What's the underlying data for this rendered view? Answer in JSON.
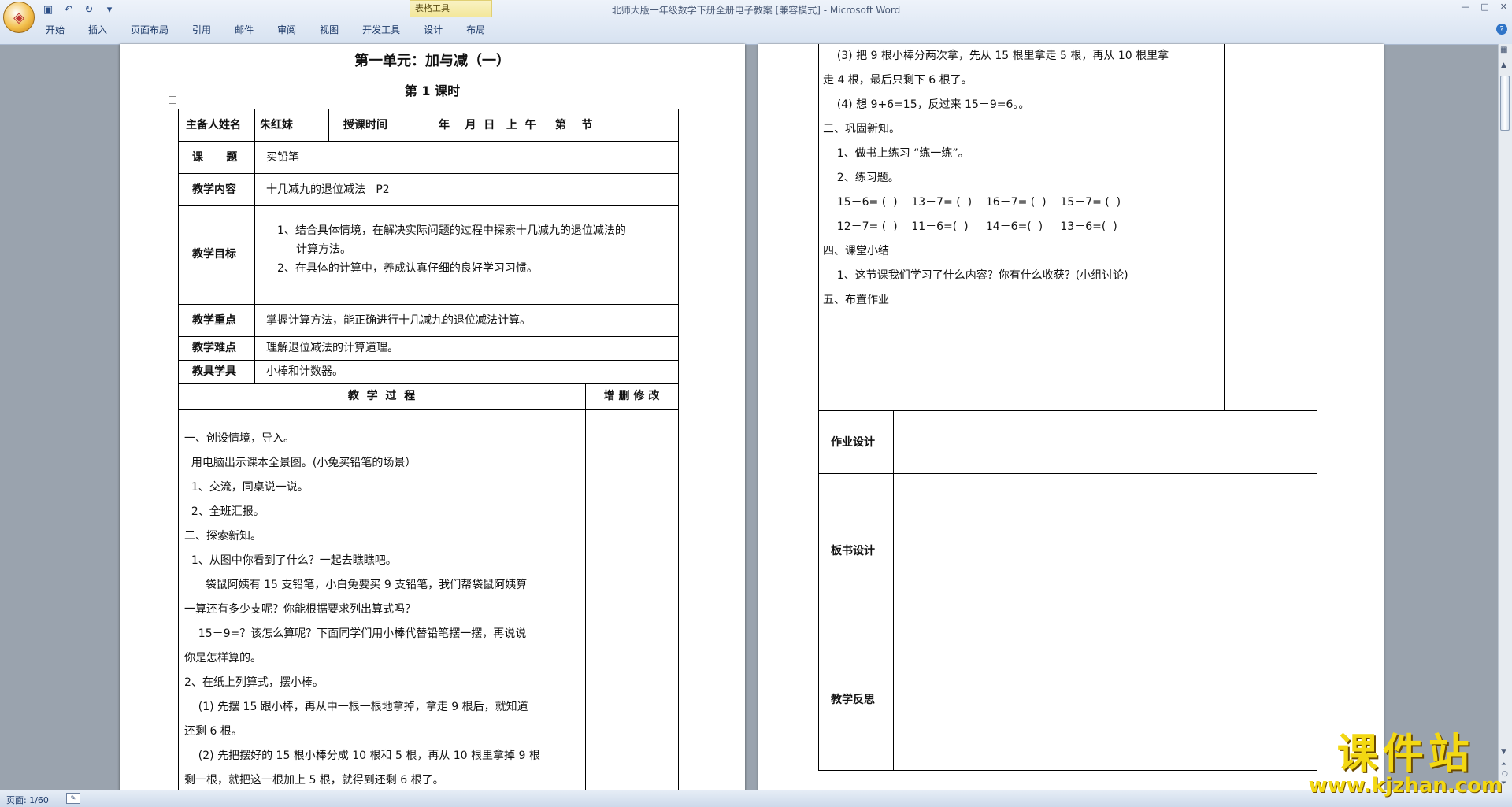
{
  "window": {
    "title": "北师大版一年级数学下册全册电子教案 [兼容模式] - Microsoft Word",
    "contextual_tools": "表格工具",
    "tabs": [
      "开始",
      "插入",
      "页面布局",
      "引用",
      "邮件",
      "审阅",
      "视图",
      "开发工具",
      "设计",
      "布局"
    ]
  },
  "status": {
    "page": "页面: 1/60"
  },
  "watermark": {
    "main": "课件站",
    "url": "www.kjzhan.com"
  },
  "page1": {
    "title": "第一单元：加与减（一）",
    "subtitle": "第 1 课时",
    "preparer_label": "主备人姓名",
    "preparer_value": "朱红妹",
    "time_label": "授课时间",
    "time_value": "年    月  日   上  午     第    节",
    "topic_label": "课      题",
    "topic_value": "买铅笔",
    "content_label": "教学内容",
    "content_value": "十几减九的退位减法   P2",
    "goal_label": "教学目标",
    "goal_1a": "1、结合具体情境，在解决实际问题的过程中探索十几减九的退位减法的",
    "goal_1b": "计算方法。",
    "goal_2": "2、在具体的计算中，养成认真仔细的良好学习习惯。",
    "key_label": "教学重点",
    "key_value": "掌握计算方法，能正确进行十几减九的退位减法计算。",
    "difficulty_label": "教学难点",
    "difficulty_value": "理解退位减法的计算道理。",
    "tools_label": "教具学具",
    "tools_value": "小棒和计数器。",
    "process_label": "教  学  过  程",
    "revise_label": "增 删 修 改",
    "lines": [
      "一、创设情境，导入。",
      "  用电脑出示课本全景图。(小兔买铅笔的场景）",
      "  1、交流，同桌说一说。",
      "  2、全班汇报。",
      "二、探索新知。",
      "  1、从图中你看到了什么？一起去瞧瞧吧。",
      "      袋鼠阿姨有 15 支铅笔，小白兔要买 9 支铅笔，我们帮袋鼠阿姨算",
      "一算还有多少支呢？你能根据要求列出算式吗？",
      "    15－9=？该怎么算呢？下面同学们用小棒代替铅笔摆一摆，再说说",
      "你是怎样算的。",
      "2、在纸上列算式，摆小棒。",
      "    (1) 先摆 15 跟小棒，再从中一根一根地拿掉，拿走 9 根后，就知道",
      "还剩 6 根。",
      "    (2) 先把摆好的 15 根小棒分成 10 根和 5 根，再从 10 根里拿掉 9 根",
      "剩一根，就把这一根加上 5 根，就得到还剩 6 根了。"
    ]
  },
  "page2": {
    "lines": [
      "    (3) 把 9 根小棒分两次拿，先从 15 根里拿走 5 根，再从 10 根里拿",
      "走 4 根，最后只剩下 6 根了。",
      "    (4) 想 9+6=15，反过来 15－9=6。。",
      "三、巩固新知。",
      "    1、做书上练习 “练一练”。",
      "    2、练习题。",
      "    15－6= (  )    13－7= (  )    16－7= (  )    15－7= (  )",
      "    12－7= (  )    11－6=(  )     14－6=(  )     13－6=(  )",
      "四、课堂小结",
      "    1、这节课我们学习了什么内容？你有什么收获？(小组讨论)",
      "五、布置作业"
    ],
    "homework_label": "作业设计",
    "board_label": "板书设计",
    "reflection_label": "教学反思"
  }
}
